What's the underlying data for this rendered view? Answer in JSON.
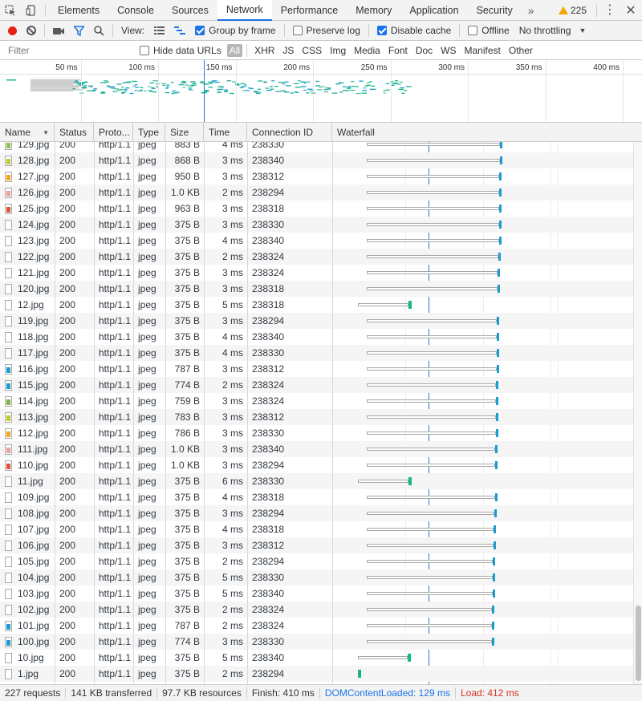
{
  "tabs": {
    "items": [
      {
        "label": "Elements"
      },
      {
        "label": "Console"
      },
      {
        "label": "Sources"
      },
      {
        "label": "Network"
      },
      {
        "label": "Performance"
      },
      {
        "label": "Memory"
      },
      {
        "label": "Application"
      },
      {
        "label": "Security"
      }
    ],
    "more": "»",
    "active": "Network",
    "warning_count": "225"
  },
  "toolbar": {
    "view_label": "View:",
    "group_by_frame": {
      "label": "Group by frame",
      "checked": true
    },
    "preserve_log": {
      "label": "Preserve log",
      "checked": false
    },
    "disable_cache": {
      "label": "Disable cache",
      "checked": true
    },
    "offline": {
      "label": "Offline",
      "checked": false
    },
    "throttling": "No throttling"
  },
  "filter": {
    "placeholder": "Filter",
    "hide_data_urls": "Hide data URLs",
    "types": [
      "All",
      "XHR",
      "JS",
      "CSS",
      "Img",
      "Media",
      "Font",
      "Doc",
      "WS",
      "Manifest",
      "Other"
    ]
  },
  "overview": {
    "ticks": [
      "50 ms",
      "100 ms",
      "150 ms",
      "200 ms",
      "250 ms",
      "300 ms",
      "350 ms",
      "400 ms"
    ]
  },
  "columns": {
    "name": "Name",
    "status": "Status",
    "protocol": "Proto...",
    "type": "Type",
    "size": "Size",
    "time": "Time",
    "connection": "Connection ID",
    "waterfall": "Waterfall"
  },
  "colors": {
    "accent": "#1a73e8",
    "receive": "#1d9bd1",
    "receive_green": "#12b886",
    "load": "#d93025",
    "record": "#e62117"
  },
  "rows": [
    {
      "name": "129.jpg",
      "status": "200",
      "protocol": "http/1.1",
      "type": "jpeg",
      "size": "883 B",
      "time": "4 ms",
      "conn": "238330",
      "icon": "#8bc34a",
      "wf_start": 0.115,
      "wf_end": 0.565
    },
    {
      "name": "128.jpg",
      "status": "200",
      "protocol": "http/1.1",
      "type": "jpeg",
      "size": "868 B",
      "time": "3 ms",
      "conn": "238340",
      "icon": "#c0ca33",
      "wf_start": 0.115,
      "wf_end": 0.565
    },
    {
      "name": "127.jpg",
      "status": "200",
      "protocol": "http/1.1",
      "type": "jpeg",
      "size": "950 B",
      "time": "3 ms",
      "conn": "238312",
      "icon": "#f5a623",
      "wf_start": 0.115,
      "wf_end": 0.563
    },
    {
      "name": "126.jpg",
      "status": "200",
      "protocol": "http/1.1",
      "type": "jpeg",
      "size": "1.0 KB",
      "time": "2 ms",
      "conn": "238294",
      "icon": "#e8a0a0",
      "wf_start": 0.115,
      "wf_end": 0.563
    },
    {
      "name": "125.jpg",
      "status": "200",
      "protocol": "http/1.1",
      "type": "jpeg",
      "size": "963 B",
      "time": "3 ms",
      "conn": "238318",
      "icon": "#e0533a",
      "wf_start": 0.115,
      "wf_end": 0.562
    },
    {
      "name": "124.jpg",
      "status": "200",
      "protocol": "http/1.1",
      "type": "jpeg",
      "size": "375 B",
      "time": "3 ms",
      "conn": "238330",
      "icon": "",
      "wf_start": 0.115,
      "wf_end": 0.562
    },
    {
      "name": "123.jpg",
      "status": "200",
      "protocol": "http/1.1",
      "type": "jpeg",
      "size": "375 B",
      "time": "4 ms",
      "conn": "238340",
      "icon": "",
      "wf_start": 0.115,
      "wf_end": 0.562
    },
    {
      "name": "122.jpg",
      "status": "200",
      "protocol": "http/1.1",
      "type": "jpeg",
      "size": "375 B",
      "time": "2 ms",
      "conn": "238324",
      "icon": "",
      "wf_start": 0.115,
      "wf_end": 0.561
    },
    {
      "name": "121.jpg",
      "status": "200",
      "protocol": "http/1.1",
      "type": "jpeg",
      "size": "375 B",
      "time": "3 ms",
      "conn": "238324",
      "icon": "",
      "wf_start": 0.115,
      "wf_end": 0.558
    },
    {
      "name": "120.jpg",
      "status": "200",
      "protocol": "http/1.1",
      "type": "jpeg",
      "size": "375 B",
      "time": "3 ms",
      "conn": "238318",
      "icon": "",
      "wf_start": 0.115,
      "wf_end": 0.558
    },
    {
      "name": "12.jpg",
      "status": "200",
      "protocol": "http/1.1",
      "type": "jpeg",
      "size": "375 B",
      "time": "5 ms",
      "conn": "238318",
      "icon": "",
      "wf_start": 0.085,
      "wf_end": 0.262,
      "green": true
    },
    {
      "name": "119.jpg",
      "status": "200",
      "protocol": "http/1.1",
      "type": "jpeg",
      "size": "375 B",
      "time": "3 ms",
      "conn": "238294",
      "icon": "",
      "wf_start": 0.115,
      "wf_end": 0.555
    },
    {
      "name": "118.jpg",
      "status": "200",
      "protocol": "http/1.1",
      "type": "jpeg",
      "size": "375 B",
      "time": "4 ms",
      "conn": "238340",
      "icon": "",
      "wf_start": 0.115,
      "wf_end": 0.555
    },
    {
      "name": "117.jpg",
      "status": "200",
      "protocol": "http/1.1",
      "type": "jpeg",
      "size": "375 B",
      "time": "4 ms",
      "conn": "238330",
      "icon": "",
      "wf_start": 0.115,
      "wf_end": 0.554
    },
    {
      "name": "116.jpg",
      "status": "200",
      "protocol": "http/1.1",
      "type": "jpeg",
      "size": "787 B",
      "time": "3 ms",
      "conn": "238312",
      "icon": "#1d9bd1",
      "wf_start": 0.115,
      "wf_end": 0.554
    },
    {
      "name": "115.jpg",
      "status": "200",
      "protocol": "http/1.1",
      "type": "jpeg",
      "size": "774 B",
      "time": "2 ms",
      "conn": "238324",
      "icon": "#1d9bd1",
      "wf_start": 0.115,
      "wf_end": 0.553
    },
    {
      "name": "114.jpg",
      "status": "200",
      "protocol": "http/1.1",
      "type": "jpeg",
      "size": "759 B",
      "time": "3 ms",
      "conn": "238324",
      "icon": "#7cb342",
      "wf_start": 0.115,
      "wf_end": 0.552
    },
    {
      "name": "113.jpg",
      "status": "200",
      "protocol": "http/1.1",
      "type": "jpeg",
      "size": "783 B",
      "time": "3 ms",
      "conn": "238312",
      "icon": "#c0ca33",
      "wf_start": 0.115,
      "wf_end": 0.551
    },
    {
      "name": "112.jpg",
      "status": "200",
      "protocol": "http/1.1",
      "type": "jpeg",
      "size": "786 B",
      "time": "3 ms",
      "conn": "238330",
      "icon": "#f5a623",
      "wf_start": 0.115,
      "wf_end": 0.551
    },
    {
      "name": "111.jpg",
      "status": "200",
      "protocol": "http/1.1",
      "type": "jpeg",
      "size": "1.0 KB",
      "time": "3 ms",
      "conn": "238340",
      "icon": "#e8a0a0",
      "wf_start": 0.115,
      "wf_end": 0.55
    },
    {
      "name": "110.jpg",
      "status": "200",
      "protocol": "http/1.1",
      "type": "jpeg",
      "size": "1.0 KB",
      "time": "3 ms",
      "conn": "238294",
      "icon": "#e0533a",
      "wf_start": 0.115,
      "wf_end": 0.55
    },
    {
      "name": "11.jpg",
      "status": "200",
      "protocol": "http/1.1",
      "type": "jpeg",
      "size": "375 B",
      "time": "6 ms",
      "conn": "238330",
      "icon": "",
      "wf_start": 0.085,
      "wf_end": 0.262,
      "green": true
    },
    {
      "name": "109.jpg",
      "status": "200",
      "protocol": "http/1.1",
      "type": "jpeg",
      "size": "375 B",
      "time": "4 ms",
      "conn": "238318",
      "icon": "",
      "wf_start": 0.115,
      "wf_end": 0.548
    },
    {
      "name": "108.jpg",
      "status": "200",
      "protocol": "http/1.1",
      "type": "jpeg",
      "size": "375 B",
      "time": "3 ms",
      "conn": "238294",
      "icon": "",
      "wf_start": 0.115,
      "wf_end": 0.546
    },
    {
      "name": "107.jpg",
      "status": "200",
      "protocol": "http/1.1",
      "type": "jpeg",
      "size": "375 B",
      "time": "4 ms",
      "conn": "238318",
      "icon": "",
      "wf_start": 0.115,
      "wf_end": 0.544
    },
    {
      "name": "106.jpg",
      "status": "200",
      "protocol": "http/1.1",
      "type": "jpeg",
      "size": "375 B",
      "time": "3 ms",
      "conn": "238312",
      "icon": "",
      "wf_start": 0.115,
      "wf_end": 0.543
    },
    {
      "name": "105.jpg",
      "status": "200",
      "protocol": "http/1.1",
      "type": "jpeg",
      "size": "375 B",
      "time": "2 ms",
      "conn": "238294",
      "icon": "",
      "wf_start": 0.115,
      "wf_end": 0.542
    },
    {
      "name": "104.jpg",
      "status": "200",
      "protocol": "http/1.1",
      "type": "jpeg",
      "size": "375 B",
      "time": "5 ms",
      "conn": "238330",
      "icon": "",
      "wf_start": 0.115,
      "wf_end": 0.541
    },
    {
      "name": "103.jpg",
      "status": "200",
      "protocol": "http/1.1",
      "type": "jpeg",
      "size": "375 B",
      "time": "5 ms",
      "conn": "238340",
      "icon": "",
      "wf_start": 0.115,
      "wf_end": 0.541
    },
    {
      "name": "102.jpg",
      "status": "200",
      "protocol": "http/1.1",
      "type": "jpeg",
      "size": "375 B",
      "time": "2 ms",
      "conn": "238324",
      "icon": "",
      "wf_start": 0.115,
      "wf_end": 0.539
    },
    {
      "name": "101.jpg",
      "status": "200",
      "protocol": "http/1.1",
      "type": "jpeg",
      "size": "787 B",
      "time": "2 ms",
      "conn": "238324",
      "icon": "#1d9bd1",
      "wf_start": 0.115,
      "wf_end": 0.538
    },
    {
      "name": "100.jpg",
      "status": "200",
      "protocol": "http/1.1",
      "type": "jpeg",
      "size": "774 B",
      "time": "3 ms",
      "conn": "238330",
      "icon": "#1d9bd1",
      "wf_start": 0.115,
      "wf_end": 0.538
    },
    {
      "name": "10.jpg",
      "status": "200",
      "protocol": "http/1.1",
      "type": "jpeg",
      "size": "375 B",
      "time": "5 ms",
      "conn": "238340",
      "icon": "",
      "wf_start": 0.085,
      "wf_end": 0.258,
      "green": true
    },
    {
      "name": "1.jpg",
      "status": "200",
      "protocol": "http/1.1",
      "type": "jpeg",
      "size": "375 B",
      "time": "2 ms",
      "conn": "238294",
      "icon": "",
      "wf_start": 0.085,
      "wf_end": 0.094,
      "green": true
    }
  ],
  "status_bar": {
    "requests": "227 requests",
    "transferred": "141 KB transferred",
    "resources": "97.7 KB resources",
    "finish": "Finish: 410 ms",
    "dom_content_loaded": "DOMContentLoaded: 129 ms",
    "load": "Load: 412 ms"
  }
}
